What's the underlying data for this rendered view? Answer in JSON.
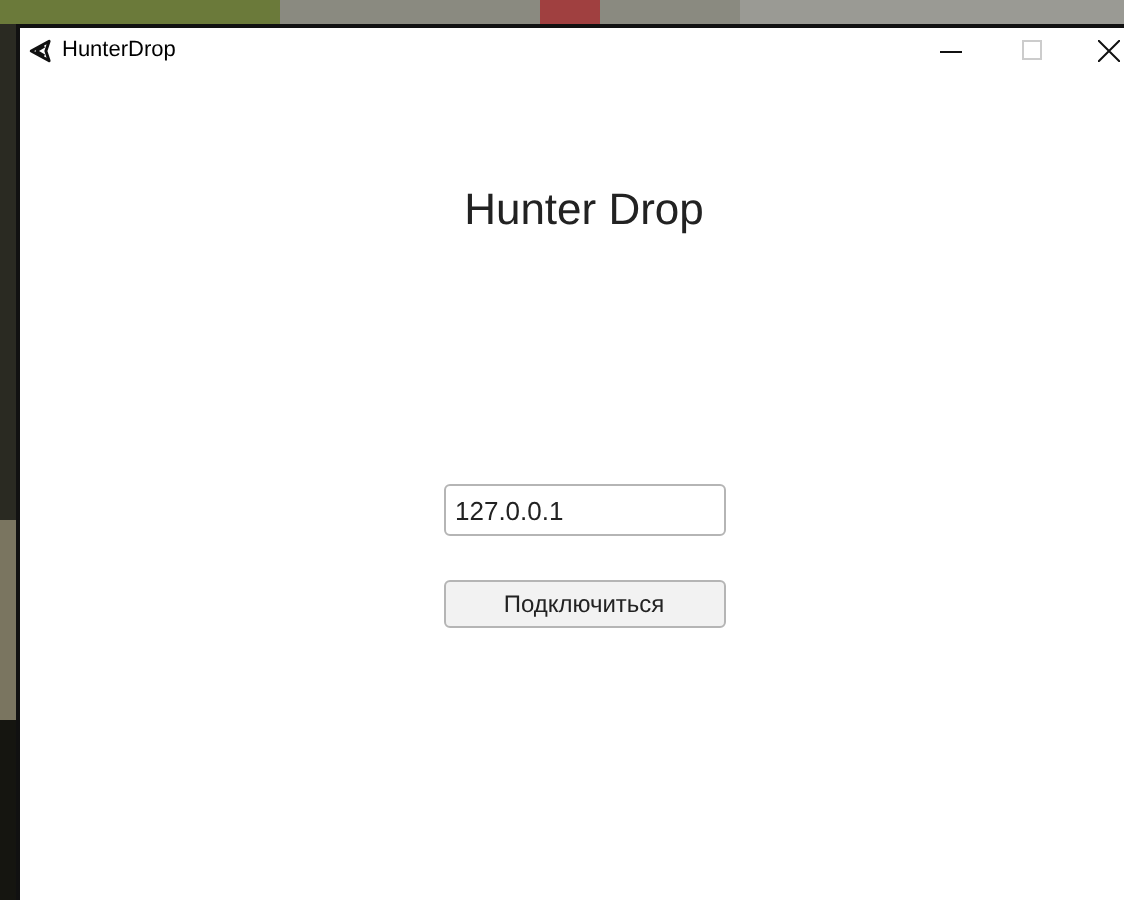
{
  "window": {
    "title": "HunterDrop"
  },
  "heading": "Hunter Drop",
  "address_field": {
    "value": "127.0.0.1"
  },
  "connect_button": {
    "label": "Подключиться"
  }
}
